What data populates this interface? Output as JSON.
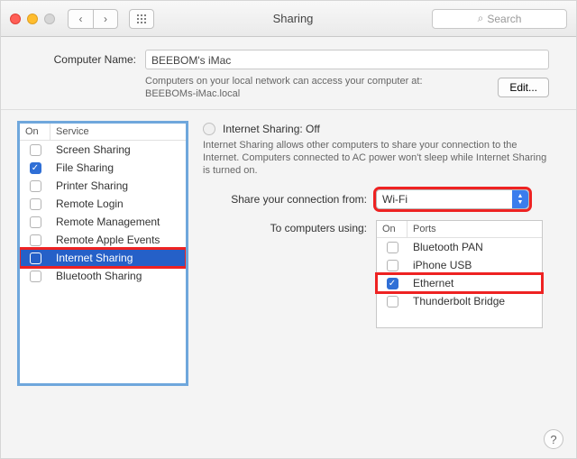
{
  "titlebar": {
    "title": "Sharing",
    "search_placeholder": "Search"
  },
  "identity": {
    "label": "Computer Name:",
    "value": "BEEBOM's iMac",
    "hint_prefix": "Computers on your local network can access your computer at:",
    "hint_host": "BEEBOMs-iMac.local",
    "edit_label": "Edit..."
  },
  "services": {
    "col_on": "On",
    "col_service": "Service",
    "items": [
      {
        "label": "Screen Sharing",
        "checked": false,
        "selected": false
      },
      {
        "label": "File Sharing",
        "checked": true,
        "selected": false
      },
      {
        "label": "Printer Sharing",
        "checked": false,
        "selected": false
      },
      {
        "label": "Remote Login",
        "checked": false,
        "selected": false
      },
      {
        "label": "Remote Management",
        "checked": false,
        "selected": false
      },
      {
        "label": "Remote Apple Events",
        "checked": false,
        "selected": false
      },
      {
        "label": "Internet Sharing",
        "checked": false,
        "selected": true
      },
      {
        "label": "Bluetooth Sharing",
        "checked": false,
        "selected": false
      }
    ]
  },
  "details": {
    "heading": "Internet Sharing: Off",
    "description": "Internet Sharing allows other computers to share your connection to the Internet. Computers connected to AC power won't sleep while Internet Sharing is turned on.",
    "share_from_label": "Share your connection from:",
    "share_from_value": "Wi-Fi",
    "to_label": "To computers using:",
    "ports_col_on": "On",
    "ports_col_ports": "Ports",
    "ports": [
      {
        "label": "Bluetooth PAN",
        "checked": false
      },
      {
        "label": "iPhone USB",
        "checked": false
      },
      {
        "label": "Ethernet",
        "checked": true
      },
      {
        "label": "Thunderbolt Bridge",
        "checked": false
      }
    ]
  },
  "help_label": "?"
}
